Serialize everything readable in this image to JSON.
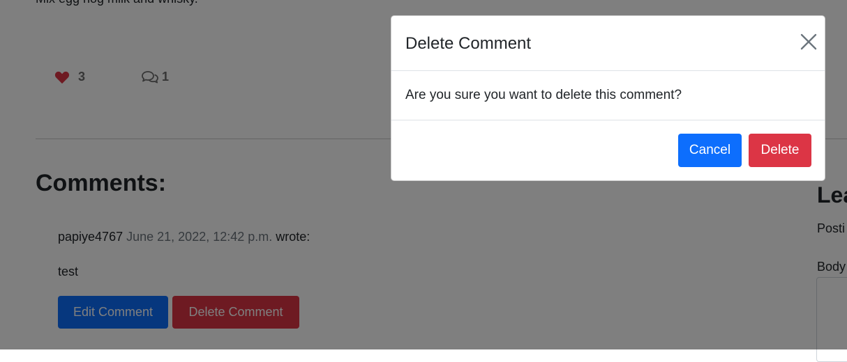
{
  "post": {
    "text": "Mix egg nog milk and whisky.",
    "likes_count": "3",
    "comments_count": "1"
  },
  "comments": {
    "title": "Comments:",
    "items": [
      {
        "author": "papiye4767",
        "date": "June 21, 2022, 12:42 p.m.",
        "suffix": "wrote:",
        "body": "test",
        "edit_label": "Edit Comment",
        "delete_label": "Delete Comment"
      }
    ]
  },
  "sidebar": {
    "heading": "Lea",
    "posting": "Posti",
    "body_label": "Body"
  },
  "modal": {
    "title": "Delete Comment",
    "message": "Are you sure you want to delete this comment?",
    "cancel_label": "Cancel",
    "delete_label": "Delete"
  },
  "icons": {
    "like": "heart-icon",
    "comments": "comments-icon",
    "close": "close-icon"
  },
  "colors": {
    "primary": "#0d6efd",
    "danger": "#dc3545",
    "heart": "#dc3545",
    "backdrop": "rgba(0,0,0,0.5)"
  }
}
